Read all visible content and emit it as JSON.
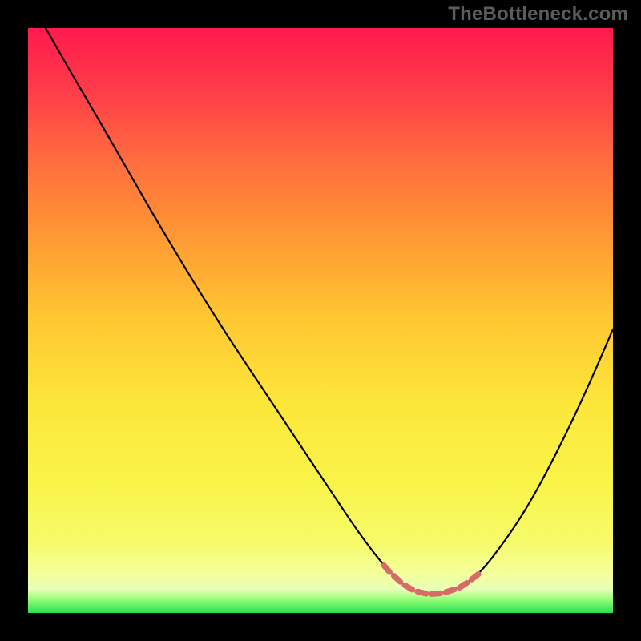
{
  "watermark": "TheBottleneck.com",
  "colors": {
    "gradient_top": "#ff1a4d",
    "gradient_mid": "#fde63a",
    "gradient_bottom": "#27e04e",
    "curve": "#000000",
    "dash": "#d86a6a"
  },
  "chart_data": {
    "type": "line",
    "title": "",
    "xlabel": "",
    "ylabel": "",
    "xlim": [
      0,
      100
    ],
    "ylim": [
      0,
      100
    ],
    "x": [
      3,
      7,
      12,
      18,
      25,
      33,
      42,
      51,
      57,
      61.5,
      64,
      66,
      68.5,
      71,
      74,
      77,
      80,
      85,
      90,
      95,
      100
    ],
    "values": [
      100,
      93,
      84.5,
      74,
      62,
      49,
      35.5,
      22,
      13,
      7.3,
      5.0,
      3.8,
      3.2,
      3.4,
      4.4,
      6.6,
      10.2,
      17.4,
      26.6,
      37,
      48.5
    ],
    "optimal_x_range": [
      60.5,
      78
    ],
    "description": "V-shaped bottleneck curve. y-axis is bottleneck severity (100 = worst, 0 = ideal). Trough near x≈68 marks the balanced configuration; salmon dashes highlight the low-bottleneck window (~60–78)."
  }
}
